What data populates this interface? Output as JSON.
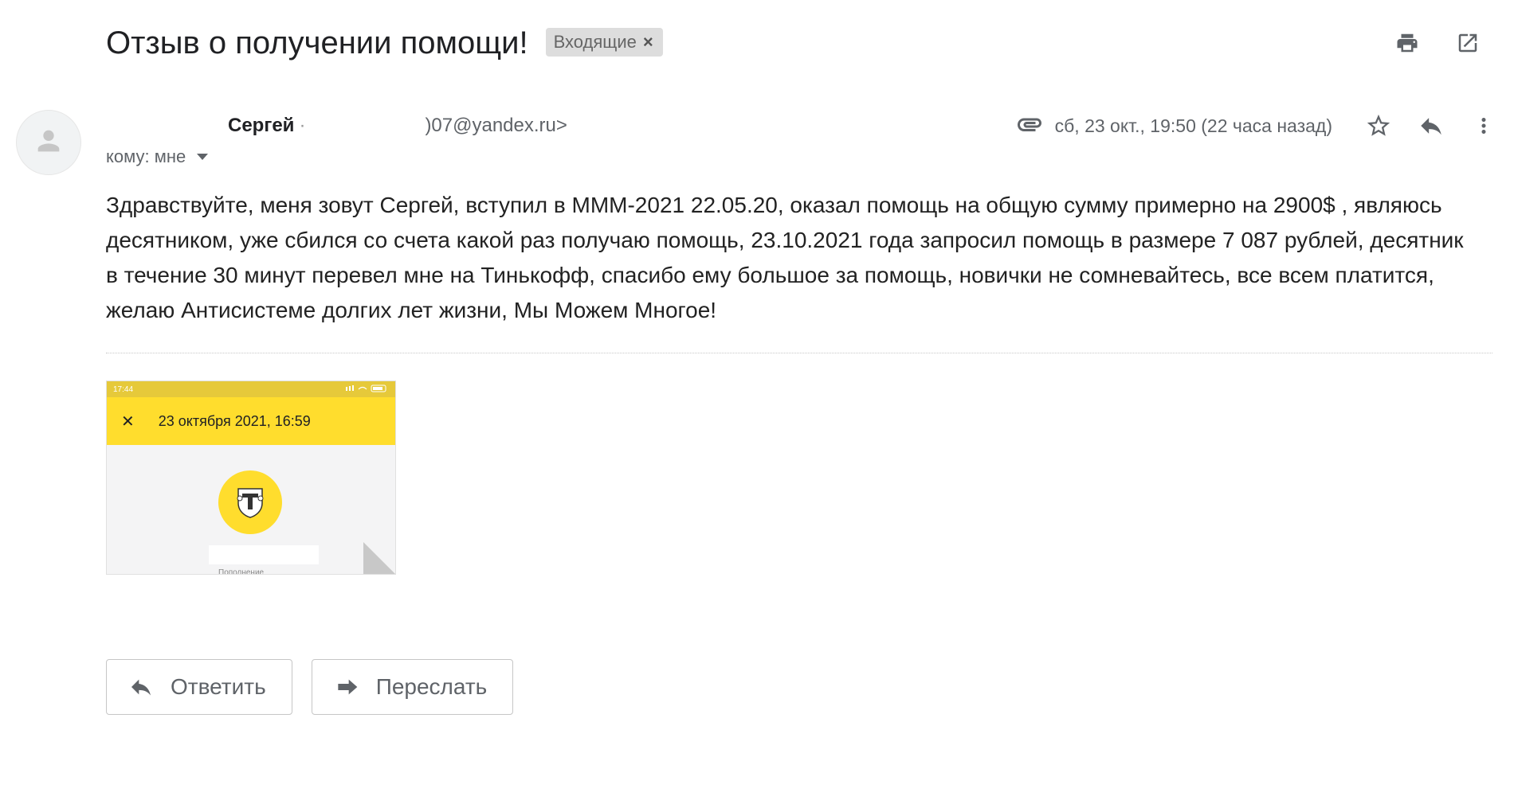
{
  "email": {
    "subject": "Отзыв о получении помощи!",
    "label": "Входящие",
    "sender_name": "Сергей",
    "sender_email_partial": ")07@yandex.ru>",
    "date": "сб, 23 окт., 19:50 (22 часа назад)",
    "to_text": "кому: мне",
    "body": "Здравствуйте, меня зовут Сергей, вступил в МММ-2021 22.05.20, оказал помощь на общую сумму примерно на 2900$ , являюсь десятником, уже сбился со счета какой раз получаю помощь, 23.10.2021 года запросил помощь в размере 7 087 рублей, десятник в течение 30 минут перевел мне на Тинькофф, спасибо ему большое за помощь, новички не сомневайтесь, все всем платится, желаю Антисистеме долгих лет жизни, Мы Можем Многое!"
  },
  "attachment": {
    "status_time": "17:44",
    "header_title": "23 октября 2021, 16:59",
    "close_glyph": "✕",
    "small_text": "Пополнение"
  },
  "actions": {
    "reply_label": "Ответить",
    "forward_label": "Переслать"
  },
  "icons": {
    "print": "printer-icon",
    "open_new_window": "open-in-new-icon",
    "attachment": "paperclip-icon",
    "star": "star-icon",
    "reply": "reply-icon",
    "more": "more-vertical-icon",
    "avatar": "person-icon",
    "forward": "forward-icon"
  },
  "colors": {
    "tinkoff_yellow": "#ffdd2d",
    "label_bg": "#dddddd"
  }
}
